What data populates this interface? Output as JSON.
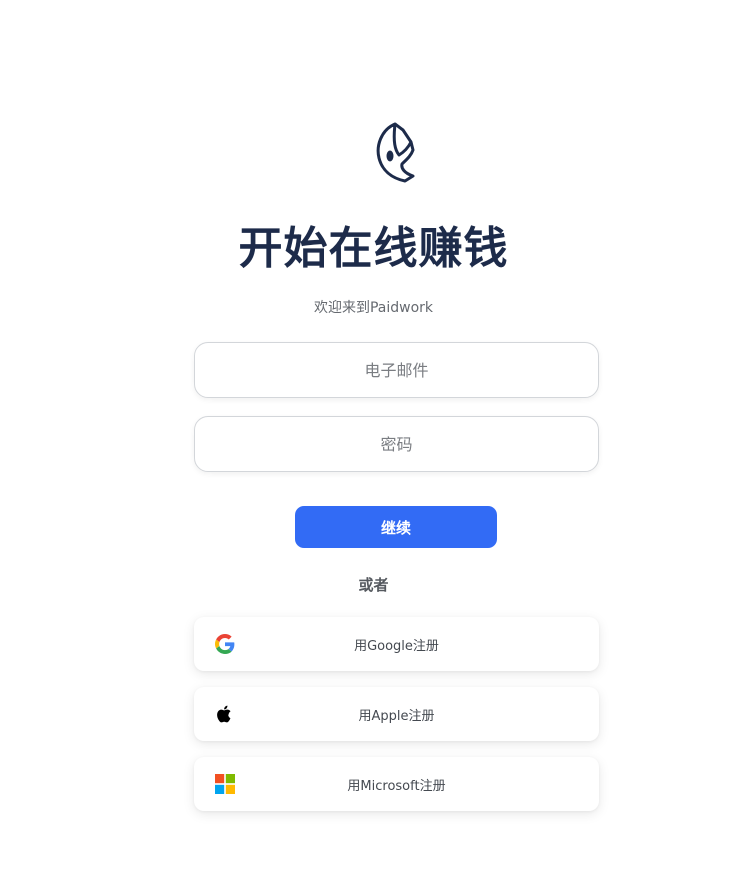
{
  "headline": "开始在线赚钱",
  "welcome": "欢迎来到Paidwork",
  "form": {
    "email_placeholder": "电子邮件",
    "password_placeholder": "密码",
    "continue_label": "继续"
  },
  "divider": "或者",
  "social": {
    "google_label": "用Google注册",
    "apple_label": "用Apple注册",
    "microsoft_label": "用Microsoft注册"
  },
  "colors": {
    "brand_navy": "#1d2b4a",
    "primary_blue": "#326bf5"
  },
  "icons": {
    "logo": "paidwork-logo",
    "google": "google-icon",
    "apple": "apple-icon",
    "microsoft": "microsoft-icon"
  }
}
